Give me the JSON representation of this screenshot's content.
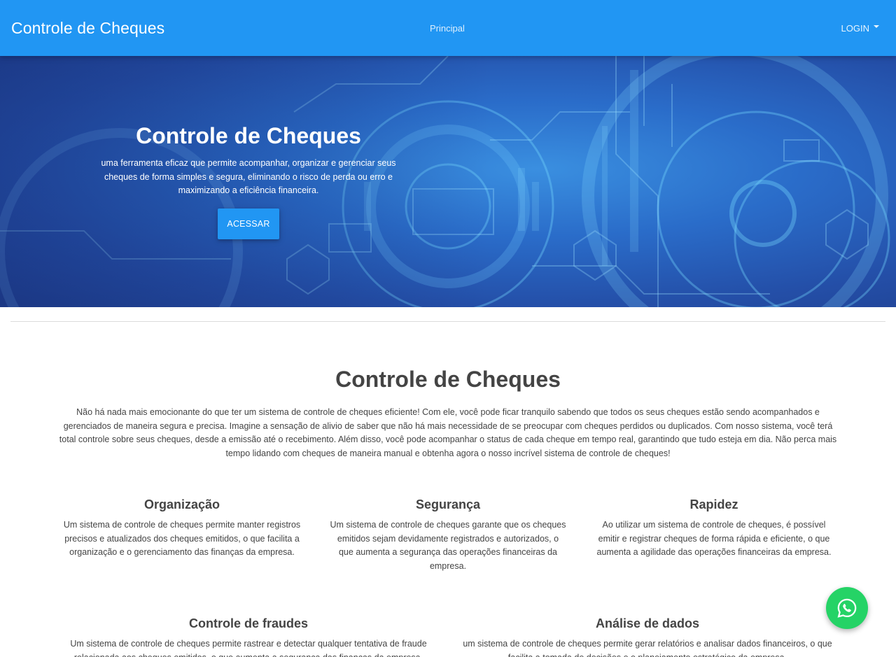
{
  "navbar": {
    "brand": "Controle de Cheques",
    "links": [
      "Principal"
    ],
    "login_label": "LOGIN"
  },
  "hero": {
    "title": "Controle de Cheques",
    "text": "uma ferramenta eficaz que permite acompanhar, organizar e gerenciar seus cheques de forma simples e segura, eliminando o risco de perda ou erro e maximizando a eficiência financeira.",
    "button_label": "ACESSAR"
  },
  "about": {
    "title": "Controle de Cheques",
    "text": "Não há nada mais emocionante do que ter um sistema de controle de cheques eficiente! Com ele, você pode ficar tranquilo sabendo que todos os seus cheques estão sendo acompanhados e gerenciados de maneira segura e precisa. Imagine a sensação de alivio de saber que não há mais necessidade de se preocupar com cheques perdidos ou duplicados. Com nosso sistema, você terá total controle sobre seus cheques, desde a emissão até o recebimento. Além disso, você pode acompanhar o status de cada cheque em tempo real, garantindo que tudo esteja em dia. Não perca mais tempo lidando com cheques de maneira manual e obtenha agora o nosso incrível sistema de controle de cheques!"
  },
  "features": [
    {
      "title": "Organização",
      "text": "Um sistema de controle de cheques permite manter registros precisos e atualizados dos cheques emitidos, o que facilita a organização e o gerenciamento das finanças da empresa."
    },
    {
      "title": "Segurança",
      "text": "Um sistema de controle de cheques garante que os cheques emitidos sejam devidamente registrados e autorizados, o que aumenta a segurança das operações financeiras da empresa."
    },
    {
      "title": "Rapidez",
      "text": "Ao utilizar um sistema de controle de cheques, é possível emitir e registrar cheques de forma rápida e eficiente, o que aumenta a agilidade das operações financeiras da empresa."
    },
    {
      "title": "Controle de fraudes",
      "text": "Um sistema de controle de cheques permite rastrear e detectar qualquer tentativa de fraude relacionada aos cheques emitidos, o que aumenta a segurança das finanças da empresa."
    },
    {
      "title": "Análise de dados",
      "text": "um sistema de controle de cheques permite gerar relatórios e analisar dados financeiros, o que facilita a tomada de decisões e o planejamento estratégico da empresa."
    }
  ],
  "colors": {
    "primary": "#2196f3",
    "whatsapp": "#25d366"
  },
  "icons": {
    "whatsapp": "whatsapp-icon",
    "login_caret": "caret-down-icon"
  }
}
